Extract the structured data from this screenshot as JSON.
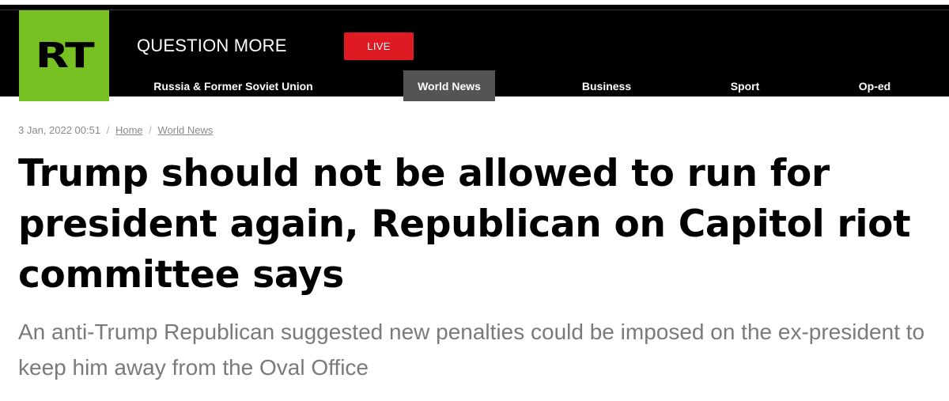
{
  "header": {
    "logo_text": "RT",
    "tagline": "QUESTION MORE",
    "live_label": "LIVE",
    "brand_color": "#77c123",
    "live_color": "#e01a22"
  },
  "nav": {
    "items": [
      {
        "label": "Russia & Former Soviet Union",
        "active": false
      },
      {
        "label": "World News",
        "active": true
      },
      {
        "label": "Business",
        "active": false
      },
      {
        "label": "Sport",
        "active": false
      },
      {
        "label": "Op-ed",
        "active": false
      }
    ]
  },
  "article": {
    "date": "3 Jan, 2022 00:51",
    "breadcrumb": [
      "Home",
      "World News"
    ],
    "headline": "Trump should not be allowed to run for president again, Republican on Capitol riot committee says",
    "summary": "An anti-Trump Republican suggested new penalties could be imposed on the ex-president to keep him away from the Oval Office"
  }
}
